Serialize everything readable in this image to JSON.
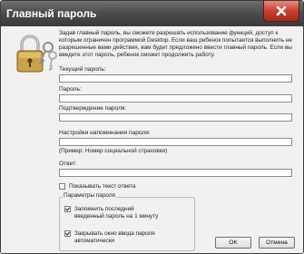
{
  "window": {
    "title": "Главный пароль"
  },
  "description": "Задав главный пароль, вы сможете разрешать использование функций, доступ к которым ограничен программой Desktop. Если ваш ребенок попытается выполнить не разрешенные вами действия, вам будет предложено ввести главный пароль. Если вы введете этот пароль, ребенок сможет продолжить работу.",
  "fields": {
    "current_password_label": "Текущий пароль:",
    "password_label": "Пароль:",
    "confirm_label": "Подтверждение пароля:",
    "hint_label": "Настройки напоминания пароля:",
    "hint_example": "(Пример: Номер социальной страховки)",
    "answer_label": "Ответ:",
    "current_password_value": "",
    "password_value": "",
    "confirm_value": "",
    "hint_value": "",
    "answer_value": ""
  },
  "show_answer": {
    "label": "Показывать текст ответа",
    "checked": false
  },
  "params": {
    "legend": "Параметры пароля",
    "remember_label": "Запомнить последний введенный пароль на 1 минуту",
    "remember_checked": true,
    "autoclose_label": "Закрывать окно ввода пароля автоматически",
    "autoclose_checked": true
  },
  "buttons": {
    "ok": "OK",
    "cancel": "Отмена"
  },
  "icons": {
    "lock": "padlock-with-keys-icon",
    "close": "close-icon"
  }
}
